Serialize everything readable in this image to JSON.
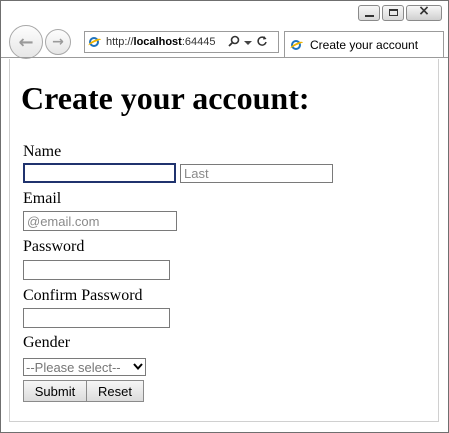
{
  "browser": {
    "address": {
      "scheme": "http://",
      "host": "localhost",
      "port_fragment": ":64445"
    },
    "tab": {
      "title": "Create your account"
    },
    "icons": {
      "back": "back-arrow-icon",
      "forward": "forward-arrow-icon",
      "site": "ie-page-icon",
      "search": "search-icon",
      "dropdown": "chevron-down-icon",
      "refresh": "refresh-icon"
    }
  },
  "form": {
    "title": "Create your account:",
    "name_label": "Name",
    "first_name": {
      "value": "",
      "placeholder": ""
    },
    "last_name": {
      "value": "",
      "placeholder": "Last"
    },
    "email_label": "Email",
    "email": {
      "value": "",
      "placeholder": "@email.com"
    },
    "password_label": "Password",
    "password": {
      "value": ""
    },
    "confirm_label": "Confirm Password",
    "confirm_password": {
      "value": ""
    },
    "gender_label": "Gender",
    "gender": {
      "selected": "--Please select--"
    },
    "submit_label": "Submit",
    "reset_label": "Reset"
  }
}
